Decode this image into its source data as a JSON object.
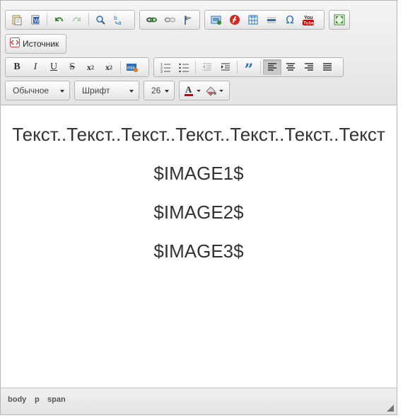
{
  "toolbar": {
    "source_label": "Источник",
    "format_value": "Обычное",
    "font_value": "Шрифт",
    "size_value": "26",
    "colors": {
      "text_color_underline": "#cc0000",
      "youtube_red": "#cc0000",
      "flash_red": "#d12b1f",
      "undo_green": "#3a8a2f",
      "accent_blue": "#2a6ebb"
    }
  },
  "content": {
    "line1": "Текст..Текст..Текст..Текст..Текст..Текст..Текст",
    "line2": "$IMAGE1$",
    "line3": "$IMAGE2$",
    "line4": "$IMAGE3$"
  },
  "statusbar": {
    "path": [
      "body",
      "p",
      "span"
    ]
  }
}
